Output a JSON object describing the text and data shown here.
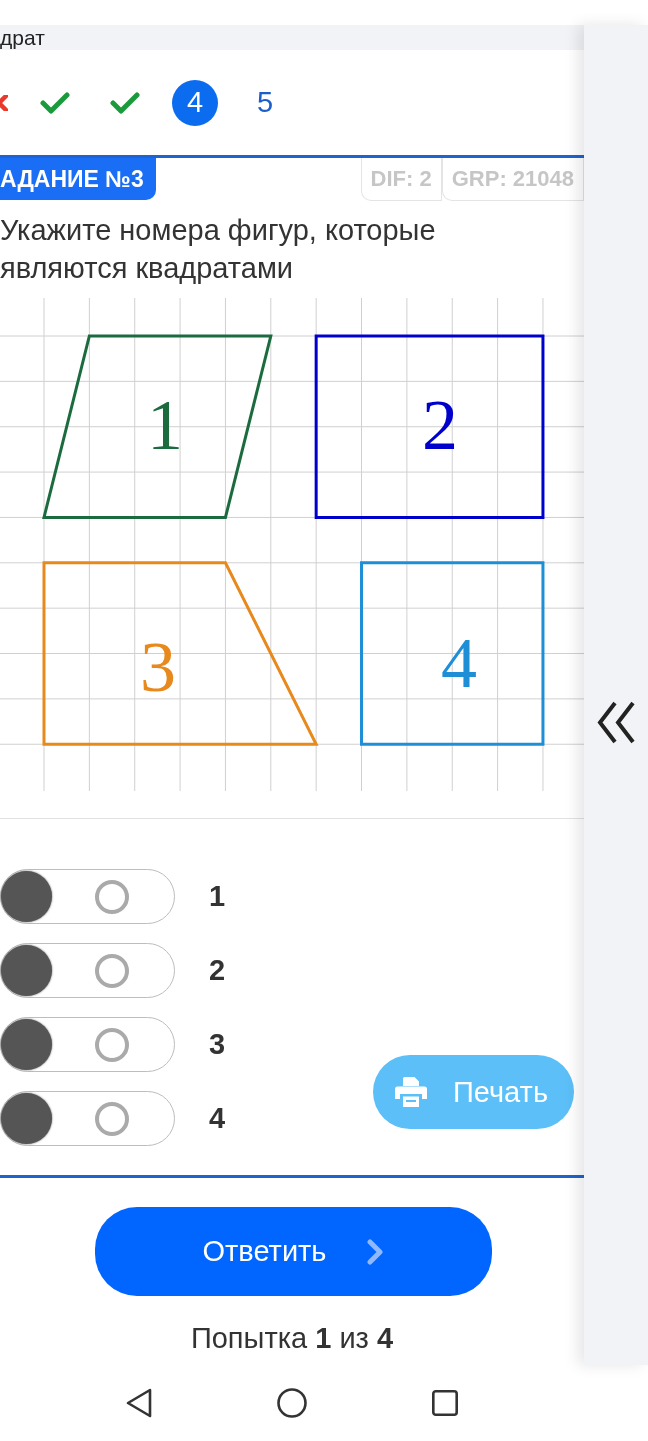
{
  "top_bar": {
    "title": "драт"
  },
  "question_nav": [
    {
      "kind": "wrong",
      "selected": false
    },
    {
      "kind": "correct",
      "selected": false
    },
    {
      "kind": "correct",
      "selected": false
    },
    {
      "kind": "number",
      "label": "4",
      "selected": true
    },
    {
      "kind": "number",
      "label": "5",
      "selected": false
    }
  ],
  "task": {
    "badge": "АДАНИЕ №3",
    "tags": [
      "DIF: 2",
      "GRP: 21048"
    ],
    "question": "Укажите номера фигур, которые являются квадратами"
  },
  "figure": {
    "shapes": [
      {
        "kind": "parallelogram",
        "label": "1",
        "color": "#1b6b3f"
      },
      {
        "kind": "rectangle",
        "label": "2",
        "color": "#0000cc"
      },
      {
        "kind": "trapezoid",
        "label": "3",
        "color": "#e8891d"
      },
      {
        "kind": "square",
        "label": "4",
        "color": "#1e8fd6"
      }
    ]
  },
  "options": [
    {
      "label": "1",
      "checked": false
    },
    {
      "label": "2",
      "checked": false
    },
    {
      "label": "3",
      "checked": false
    },
    {
      "label": "4",
      "checked": false
    }
  ],
  "print_button": "Печать",
  "submit_button": "Ответить",
  "attempts": "Попытка **1** из **4**"
}
